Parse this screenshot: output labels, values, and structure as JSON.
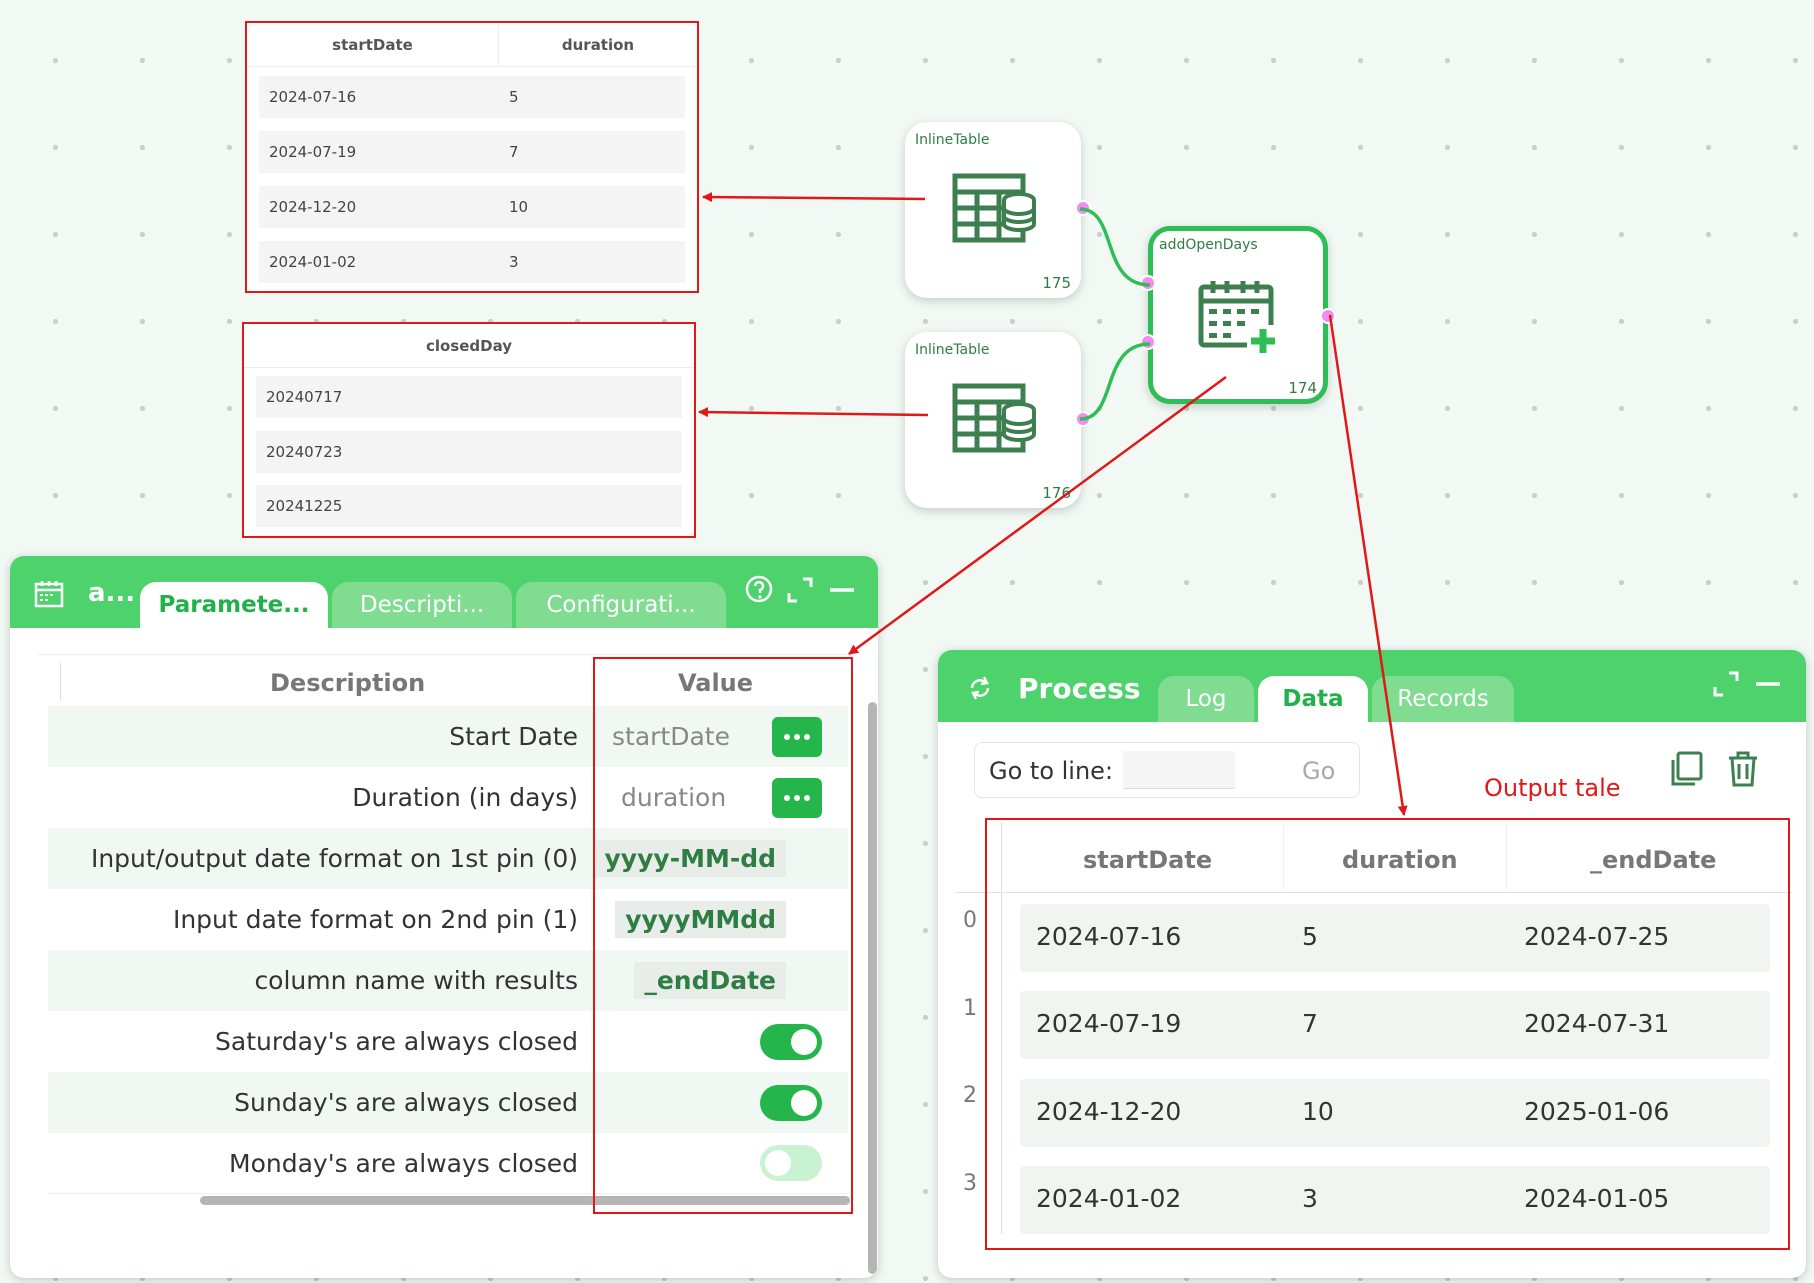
{
  "table1": {
    "headers": [
      "startDate",
      "duration"
    ],
    "rows": [
      [
        "2024-07-16",
        "5"
      ],
      [
        "2024-07-19",
        "7"
      ],
      [
        "2024-12-20",
        "10"
      ],
      [
        "2024-01-02",
        "3"
      ]
    ]
  },
  "table2": {
    "headers": [
      "closedDay"
    ],
    "rows": [
      "20240717",
      "20240723",
      "20241225"
    ]
  },
  "nodes": {
    "inline1": {
      "title": "InlineTable",
      "id": "175"
    },
    "inline2": {
      "title": "InlineTable",
      "id": "176"
    },
    "addOpenDays": {
      "title": "addOpenDays",
      "id": "174"
    }
  },
  "params_panel": {
    "title": "a...",
    "tabs": [
      "Paramete...",
      "Descripti...",
      "Configurati..."
    ],
    "headers": {
      "description": "Description",
      "value": "Value"
    },
    "rows": [
      {
        "desc": "Start Date",
        "value": "startDate"
      },
      {
        "desc": "Duration (in days)",
        "value": "duration"
      },
      {
        "desc": "Input/output date format on 1st pin (0)",
        "value": "yyyy-MM-dd"
      },
      {
        "desc": "Input date format on 2nd pin (1)",
        "value": "yyyyMMdd"
      },
      {
        "desc": "column name with results",
        "value": "_endDate"
      },
      {
        "desc": "Saturday's are always closed",
        "toggle": true
      },
      {
        "desc": "Sunday's are always closed",
        "toggle": true
      },
      {
        "desc": "Monday's are always closed",
        "toggle": false
      }
    ]
  },
  "process_panel": {
    "title": "Process",
    "tabs": [
      "Log",
      "Data",
      "Records"
    ],
    "active_tab": "Data",
    "goto_label": "Go to line:",
    "go_button": "Go",
    "annotation": "Output tale",
    "headers": [
      "startDate",
      "duration",
      "_endDate"
    ],
    "row_indices": [
      "0",
      "1",
      "2",
      "3"
    ],
    "rows": [
      [
        "2024-07-16",
        "5",
        "2024-07-25"
      ],
      [
        "2024-07-19",
        "7",
        "2024-07-31"
      ],
      [
        "2024-12-20",
        "10",
        "2025-01-06"
      ],
      [
        "2024-01-02",
        "3",
        "2024-01-05"
      ]
    ]
  },
  "colors": {
    "accent": "#4ed26b",
    "annotation": "#e01818",
    "pin": "#f58bf0"
  }
}
